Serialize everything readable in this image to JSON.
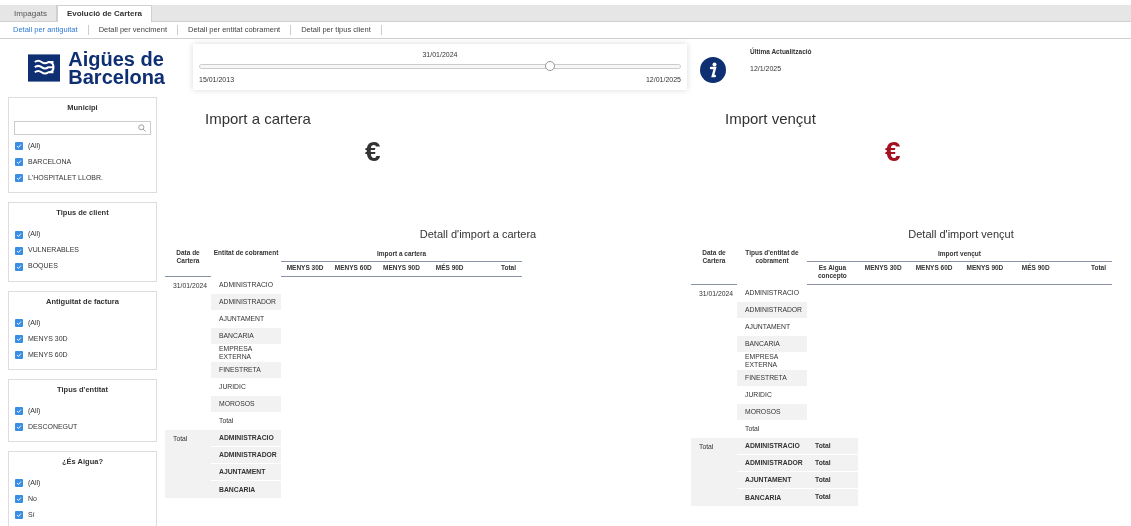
{
  "tabs": [
    {
      "label": "Impagats",
      "selected": false
    },
    {
      "label": "Evolució de Cartera",
      "selected": true
    }
  ],
  "subtabs": [
    {
      "label": "Detall per antiguitat",
      "selected": true
    },
    {
      "label": "Detall per venciment",
      "selected": false
    },
    {
      "label": "Detall per entitat cobrament",
      "selected": false
    },
    {
      "label": "Detall per tipus client",
      "selected": false
    }
  ],
  "logo": {
    "line1": "Aigües de",
    "line2": "Barcelona"
  },
  "date_slider": {
    "value": "31/01/2024",
    "min": "15/01/2013",
    "max": "12/01/2025",
    "level": 0.73
  },
  "last_update": {
    "label": "Última Actualització",
    "value": "12/1/2025"
  },
  "filters": [
    {
      "title": "Municipi",
      "search": true,
      "items": [
        {
          "label": "(All)",
          "checked": true
        },
        {
          "label": "BARCELONA",
          "checked": true
        },
        {
          "label": "L'HOSPITALET LLOBR.",
          "checked": true
        }
      ]
    },
    {
      "title": "Tipus de client",
      "search": false,
      "items": [
        {
          "label": "(All)",
          "checked": true
        },
        {
          "label": "VULNERABLES",
          "checked": true
        },
        {
          "label": "BOQUES",
          "checked": true
        }
      ]
    },
    {
      "title": "Antiguitat de factura",
      "search": false,
      "items": [
        {
          "label": "(All)",
          "checked": true
        },
        {
          "label": "MENYS 30D",
          "checked": true
        },
        {
          "label": "MENYS 60D",
          "checked": true
        }
      ]
    },
    {
      "title": "Tipus d'entitat",
      "search": false,
      "items": [
        {
          "label": "(All)",
          "checked": true
        },
        {
          "label": "DESCONEGUT",
          "checked": true
        }
      ]
    },
    {
      "title": "¿És Aigua?",
      "search": false,
      "items": [
        {
          "label": "(All)",
          "checked": true
        },
        {
          "label": "No",
          "checked": true
        },
        {
          "label": "Sí",
          "checked": true
        }
      ]
    }
  ],
  "kpis": [
    {
      "title": "Import a cartera",
      "symbol": "€",
      "color": "#333333"
    },
    {
      "title": "Import vençut",
      "symbol": "€",
      "color": "#a3121f"
    }
  ],
  "tables": [
    {
      "title": "Detall d'import a cartera",
      "col1": "Data de Cartera",
      "col2": "Entitat de cobrament",
      "group": "Import a cartera",
      "subcols": [
        "MENYS 30D",
        "MENYS 60D",
        "MENYS 90D",
        "MÉS 90D",
        "Total"
      ],
      "groups": [
        {
          "date": "31/01/2024",
          "total": false,
          "rows": [
            {
              "entity": "ADMINISTRACIO",
              "cells": []
            },
            {
              "entity": "ADMINISTRADOR",
              "cells": []
            },
            {
              "entity": "AJUNTAMENT",
              "cells": []
            },
            {
              "entity": "BANCARIA",
              "cells": []
            },
            {
              "entity": "EMPRESA EXTERNA",
              "cells": []
            },
            {
              "entity": "FINESTRETA",
              "cells": []
            },
            {
              "entity": "JURIDIC",
              "cells": []
            },
            {
              "entity": "MOROSOS",
              "cells": []
            },
            {
              "entity": "Total",
              "cells": []
            }
          ]
        },
        {
          "date": "Total",
          "total": true,
          "rows": [
            {
              "entity": "ADMINISTRACIO",
              "cells": []
            },
            {
              "entity": "ADMINISTRADOR",
              "cells": []
            },
            {
              "entity": "AJUNTAMENT",
              "cells": []
            },
            {
              "entity": "BANCARIA",
              "cells": []
            }
          ]
        }
      ]
    },
    {
      "title": "Detall d'import vençut",
      "col1": "Data de Cartera",
      "col2": "Tipus d'entitat de cobrament",
      "group": "Import vençut",
      "subcols": [
        "Es Aigua concepto",
        "MENYS 30D",
        "MENYS 60D",
        "MENYS 90D",
        "MÉS 90D",
        "Total"
      ],
      "groups": [
        {
          "date": "31/01/2024",
          "total": false,
          "rows": [
            {
              "entity": "ADMINISTRACIO",
              "cells": []
            },
            {
              "entity": "ADMINISTRADOR",
              "cells": []
            },
            {
              "entity": "AJUNTAMENT",
              "cells": []
            },
            {
              "entity": "BANCARIA",
              "cells": []
            },
            {
              "entity": "EMPRESA EXTERNA",
              "cells": []
            },
            {
              "entity": "FINESTRETA",
              "cells": []
            },
            {
              "entity": "JURIDIC",
              "cells": []
            },
            {
              "entity": "MOROSOS",
              "cells": []
            },
            {
              "entity": "Total",
              "cells": []
            }
          ]
        },
        {
          "date": "Total",
          "total": true,
          "rows": [
            {
              "entity": "ADMINISTRACIO",
              "cells": [
                "Total"
              ]
            },
            {
              "entity": "ADMINISTRADOR",
              "cells": [
                "Total"
              ]
            },
            {
              "entity": "AJUNTAMENT",
              "cells": [
                "Total"
              ]
            },
            {
              "entity": "BANCARIA",
              "cells": [
                "Total"
              ]
            }
          ]
        }
      ]
    }
  ]
}
